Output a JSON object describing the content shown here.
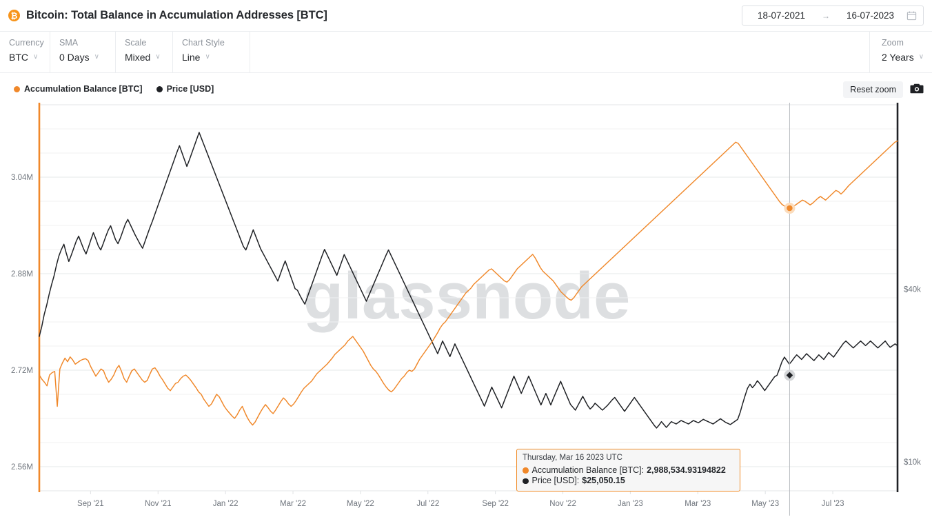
{
  "header": {
    "icon": "bitcoin-icon",
    "icon_glyph": "₿",
    "title": "Bitcoin: Total Balance in Accumulation Addresses [BTC]",
    "date_from": "18-07-2021",
    "date_arrow": "→",
    "date_to": "16-07-2023",
    "calendar_icon": "calendar-icon"
  },
  "toolbar": {
    "currency": {
      "label": "Currency",
      "value": "BTC"
    },
    "sma": {
      "label": "SMA",
      "value": "0 Days"
    },
    "scale": {
      "label": "Scale",
      "value": "Mixed"
    },
    "chart_style": {
      "label": "Chart Style",
      "value": "Line"
    },
    "zoom": {
      "label": "Zoom",
      "value": "2 Years"
    },
    "caret": "∨"
  },
  "legend": {
    "items": [
      {
        "label": "Accumulation Balance [BTC]",
        "color": "#f0882a"
      },
      {
        "label": "Price [USD]",
        "color": "#1f2125"
      }
    ]
  },
  "actions": {
    "reset_zoom": "Reset zoom",
    "screenshot_icon": "camera-icon"
  },
  "watermark": "glassnode",
  "tooltip": {
    "date": "Thursday, Mar 16 2023 UTC",
    "rows": [
      {
        "color": "#f0882a",
        "key": "Accumulation Balance [BTC]:",
        "value": "2,988,534.93194822"
      },
      {
        "color": "#1f2125",
        "key": "Price [USD]:",
        "value": "$25,050.15"
      }
    ]
  },
  "chart_data": {
    "type": "line",
    "title": "Bitcoin: Total Balance in Accumulation Addresses [BTC]",
    "xlabel": "",
    "grid": true,
    "legend_position": "top-left",
    "x_ticks": [
      "Sep '21",
      "Nov '21",
      "Jan '22",
      "Mar '22",
      "May '22",
      "Jul '22",
      "Sep '22",
      "Nov '22",
      "Jan '23",
      "Mar '23",
      "May '23",
      "Jul '23"
    ],
    "x_range": [
      "18-07-2021",
      "16-07-2023"
    ],
    "axes": [
      {
        "id": "left",
        "name": "Accumulation Balance [BTC]",
        "color": "#f0882a",
        "ticks": [
          "3.04M",
          "2.88M",
          "2.72M",
          "2.56M"
        ],
        "tick_values": [
          3040000,
          2880000,
          2720000,
          2560000
        ],
        "ylim": [
          2520000,
          3160000
        ]
      },
      {
        "id": "right",
        "name": "Price [USD]",
        "color": "#1f2125",
        "ticks": [
          "$40k",
          "$10k"
        ],
        "tick_values": [
          40000,
          10000
        ],
        "ylim": [
          5000,
          72000
        ]
      }
    ],
    "cursor": {
      "x_label": "Mar 16 2023",
      "balance_marker": {
        "color": "#f0882a",
        "value": 2988534.93194822
      },
      "price_marker": {
        "color": "#1f2125",
        "value": 25050.15
      }
    },
    "series": [
      {
        "name": "Accumulation Balance [BTC]",
        "color": "#f0882a",
        "axis": "left",
        "values": [
          2712000,
          2705000,
          2700000,
          2694000,
          2712000,
          2716000,
          2718000,
          2660000,
          2722000,
          2732000,
          2740000,
          2734000,
          2742000,
          2737000,
          2730000,
          2733000,
          2736000,
          2738000,
          2739000,
          2736000,
          2726000,
          2718000,
          2710000,
          2716000,
          2722000,
          2719000,
          2708000,
          2700000,
          2705000,
          2712000,
          2722000,
          2728000,
          2718000,
          2706000,
          2700000,
          2710000,
          2719000,
          2722000,
          2716000,
          2710000,
          2704000,
          2700000,
          2703000,
          2713000,
          2722000,
          2724000,
          2718000,
          2710000,
          2704000,
          2697000,
          2690000,
          2686000,
          2692000,
          2698000,
          2700000,
          2706000,
          2710000,
          2712000,
          2708000,
          2703000,
          2697000,
          2691000,
          2684000,
          2680000,
          2672000,
          2666000,
          2660000,
          2664000,
          2672000,
          2680000,
          2676000,
          2668000,
          2660000,
          2654000,
          2649000,
          2644000,
          2640000,
          2646000,
          2654000,
          2660000,
          2650000,
          2641000,
          2634000,
          2629000,
          2634000,
          2642000,
          2650000,
          2657000,
          2663000,
          2658000,
          2652000,
          2648000,
          2654000,
          2661000,
          2668000,
          2674000,
          2670000,
          2664000,
          2660000,
          2664000,
          2670000,
          2677000,
          2684000,
          2690000,
          2694000,
          2698000,
          2702000,
          2708000,
          2714000,
          2718000,
          2722000,
          2726000,
          2730000,
          2735000,
          2740000,
          2746000,
          2750000,
          2754000,
          2758000,
          2762000,
          2768000,
          2772000,
          2776000,
          2770000,
          2764000,
          2758000,
          2752000,
          2744000,
          2736000,
          2728000,
          2722000,
          2718000,
          2712000,
          2705000,
          2698000,
          2692000,
          2687000,
          2684000,
          2688000,
          2694000,
          2700000,
          2706000,
          2710000,
          2716000,
          2720000,
          2718000,
          2722000,
          2730000,
          2738000,
          2744000,
          2750000,
          2756000,
          2762000,
          2768000,
          2775000,
          2782000,
          2790000,
          2796000,
          2800000,
          2806000,
          2812000,
          2818000,
          2824000,
          2830000,
          2836000,
          2842000,
          2848000,
          2852000,
          2856000,
          2862000,
          2866000,
          2870000,
          2874000,
          2878000,
          2882000,
          2886000,
          2888000,
          2884000,
          2880000,
          2876000,
          2872000,
          2868000,
          2866000,
          2870000,
          2876000,
          2882000,
          2888000,
          2892000,
          2896000,
          2900000,
          2904000,
          2908000,
          2912000,
          2906000,
          2898000,
          2890000,
          2884000,
          2880000,
          2876000,
          2872000,
          2868000,
          2862000,
          2856000,
          2850000,
          2846000,
          2842000,
          2838000,
          2836000,
          2840000,
          2846000,
          2852000,
          2858000,
          2862000,
          2866000,
          2870000,
          2874000,
          2878000,
          2882000,
          2886000,
          2890000,
          2894000,
          2898000,
          2902000,
          2906000,
          2910000,
          2914000,
          2918000,
          2922000,
          2926000,
          2930000,
          2934000,
          2938000,
          2942000,
          2946000,
          2950000,
          2954000,
          2958000,
          2962000,
          2966000,
          2970000,
          2974000,
          2978000,
          2982000,
          2986000,
          2990000,
          2994000,
          2998000,
          3002000,
          3006000,
          3010000,
          3014000,
          3018000,
          3022000,
          3026000,
          3030000,
          3034000,
          3038000,
          3042000,
          3046000,
          3050000,
          3054000,
          3058000,
          3062000,
          3066000,
          3070000,
          3074000,
          3078000,
          3082000,
          3086000,
          3090000,
          3094000,
          3098000,
          3096000,
          3090000,
          3084000,
          3078000,
          3072000,
          3066000,
          3060000,
          3054000,
          3048000,
          3042000,
          3036000,
          3030000,
          3024000,
          3018000,
          3012000,
          3006000,
          3000000,
          2995000,
          2992000,
          2990000,
          2988535,
          2990000,
          2993000,
          2996000,
          2999000,
          3002000,
          3000000,
          2997000,
          2994000,
          2997000,
          3001000,
          3005000,
          3008000,
          3005000,
          3002000,
          3006000,
          3010000,
          3014000,
          3018000,
          3016000,
          3012000,
          3016000,
          3021000,
          3026000,
          3030000,
          3034000,
          3038000,
          3042000,
          3046000,
          3050000,
          3054000,
          3058000,
          3062000,
          3066000,
          3070000,
          3074000,
          3078000,
          3082000,
          3086000,
          3090000,
          3094000,
          3098000,
          3100000
        ]
      },
      {
        "name": "Price [USD]",
        "color": "#1f2125",
        "axis": "right",
        "values": [
          31800,
          33500,
          35600,
          37200,
          39100,
          40800,
          42300,
          44200,
          45800,
          46900,
          47800,
          46200,
          44800,
          45900,
          47100,
          48300,
          49200,
          48100,
          47000,
          46100,
          47300,
          48600,
          49800,
          48700,
          47500,
          46800,
          47900,
          49100,
          50200,
          51000,
          49800,
          48600,
          47900,
          48900,
          50100,
          51300,
          52100,
          51200,
          50300,
          49400,
          48600,
          47800,
          47100,
          48300,
          49500,
          50700,
          51800,
          53000,
          54200,
          55400,
          56600,
          57800,
          59000,
          60200,
          61400,
          62600,
          63800,
          64900,
          63700,
          62500,
          61300,
          62400,
          63600,
          64800,
          66000,
          67200,
          66100,
          65000,
          63900,
          62800,
          61700,
          60600,
          59500,
          58400,
          57300,
          56200,
          55100,
          54000,
          52900,
          51800,
          50700,
          49600,
          48500,
          47400,
          46800,
          47900,
          49100,
          50300,
          49200,
          48100,
          47000,
          46200,
          45400,
          44600,
          43800,
          43000,
          42200,
          41400,
          42600,
          43800,
          44900,
          43700,
          42500,
          41300,
          40100,
          39800,
          38900,
          38100,
          37400,
          38600,
          39800,
          41000,
          42200,
          43400,
          44600,
          45800,
          46900,
          46000,
          45100,
          44200,
          43300,
          42400,
          43600,
          44800,
          46000,
          45100,
          44200,
          43300,
          42400,
          41500,
          40600,
          39700,
          38800,
          37900,
          38900,
          39900,
          40900,
          41900,
          42900,
          43900,
          44900,
          45900,
          46800,
          45900,
          45000,
          44100,
          43200,
          42300,
          41400,
          40500,
          39600,
          38700,
          37800,
          36900,
          36000,
          35100,
          34200,
          33300,
          32400,
          31500,
          30600,
          29700,
          28800,
          29900,
          31000,
          30100,
          29200,
          28300,
          29400,
          30500,
          29600,
          28700,
          27800,
          26900,
          26000,
          25100,
          24200,
          23300,
          22400,
          21500,
          20600,
          19700,
          20800,
          21900,
          23000,
          22100,
          21200,
          20300,
          19400,
          20500,
          21600,
          22700,
          23800,
          24900,
          23900,
          22900,
          21900,
          22900,
          23900,
          24900,
          23900,
          22900,
          21900,
          20900,
          19900,
          20900,
          21900,
          20900,
          19900,
          21000,
          22000,
          23000,
          24000,
          23000,
          22000,
          21000,
          20000,
          19500,
          19000,
          19800,
          20600,
          21400,
          20600,
          19800,
          19200,
          19600,
          20200,
          19800,
          19400,
          19000,
          19400,
          19800,
          20300,
          20800,
          21200,
          20600,
          20000,
          19400,
          18800,
          19400,
          20000,
          20600,
          21200,
          20600,
          20000,
          19400,
          18800,
          18200,
          17600,
          17000,
          16400,
          15900,
          16400,
          17000,
          16500,
          16000,
          16500,
          17000,
          16800,
          16600,
          16900,
          17200,
          17000,
          16800,
          16600,
          16900,
          17200,
          17000,
          16800,
          17100,
          17400,
          17200,
          17000,
          16800,
          16600,
          16900,
          17200,
          17500,
          17200,
          16900,
          16700,
          16500,
          16800,
          17100,
          17400,
          18600,
          20100,
          21500,
          22800,
          23500,
          22900,
          23400,
          24100,
          23600,
          23000,
          22400,
          23000,
          23600,
          24200,
          24800,
          25050,
          26200,
          27400,
          28200,
          27600,
          27000,
          27500,
          28100,
          28600,
          28200,
          27800,
          28300,
          28800,
          28400,
          28000,
          27600,
          28100,
          28600,
          28200,
          27800,
          28400,
          29000,
          28600,
          28200,
          28800,
          29400,
          30000,
          30600,
          31000,
          30600,
          30200,
          29800,
          30200,
          30600,
          31000,
          30600,
          30200,
          30600,
          31000,
          30600,
          30200,
          29800,
          30200,
          30600,
          31000,
          30400,
          29900,
          30200,
          30500,
          30200
        ]
      }
    ]
  }
}
